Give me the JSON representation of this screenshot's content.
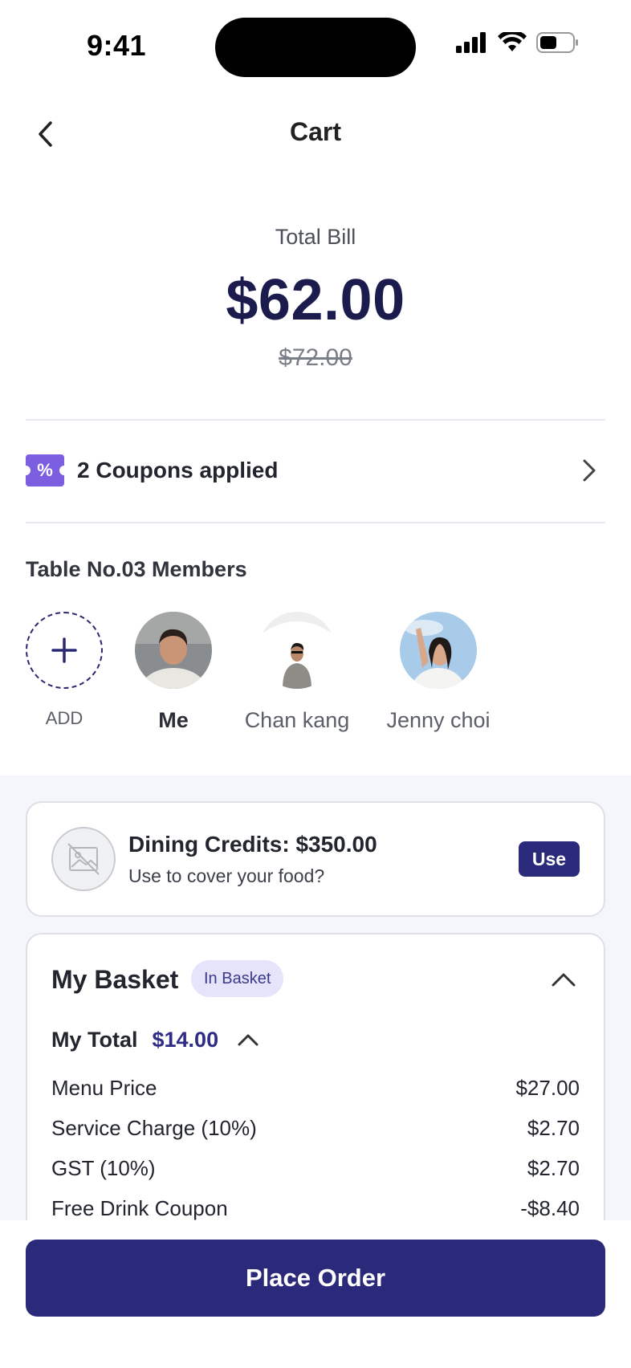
{
  "status_bar": {
    "time": "9:41"
  },
  "header": {
    "title": "Cart"
  },
  "bill": {
    "label": "Total Bill",
    "amount": "$62.00",
    "original_amount": "$72.00"
  },
  "coupons": {
    "text": "2 Coupons applied",
    "badge_symbol": "%"
  },
  "members": {
    "title": "Table No.03 Members",
    "add_label": "ADD",
    "people": [
      {
        "name": "Me"
      },
      {
        "name": "Chan kang"
      },
      {
        "name": "Jenny choi"
      }
    ]
  },
  "credits": {
    "title": "Dining Credits: $350.00",
    "subtitle": "Use to cover your food?",
    "button_label": "Use"
  },
  "basket": {
    "title": "My Basket",
    "badge": "In Basket",
    "total_label": "My Total",
    "total_value": "$14.00",
    "items": [
      {
        "label": "Menu Price",
        "value": "$27.00"
      },
      {
        "label": "Service Charge (10%)",
        "value": "$2.70"
      },
      {
        "label": "GST (10%)",
        "value": "$2.70"
      },
      {
        "label": "Free Drink Coupon",
        "value": "-$8.40"
      }
    ]
  },
  "cta": {
    "label": "Place Order"
  },
  "colors": {
    "primary": "#2b2a7a",
    "amount_text": "#1c1b4d",
    "coupon_badge": "#7b5fe0",
    "section_bg": "#f5f5fc"
  }
}
